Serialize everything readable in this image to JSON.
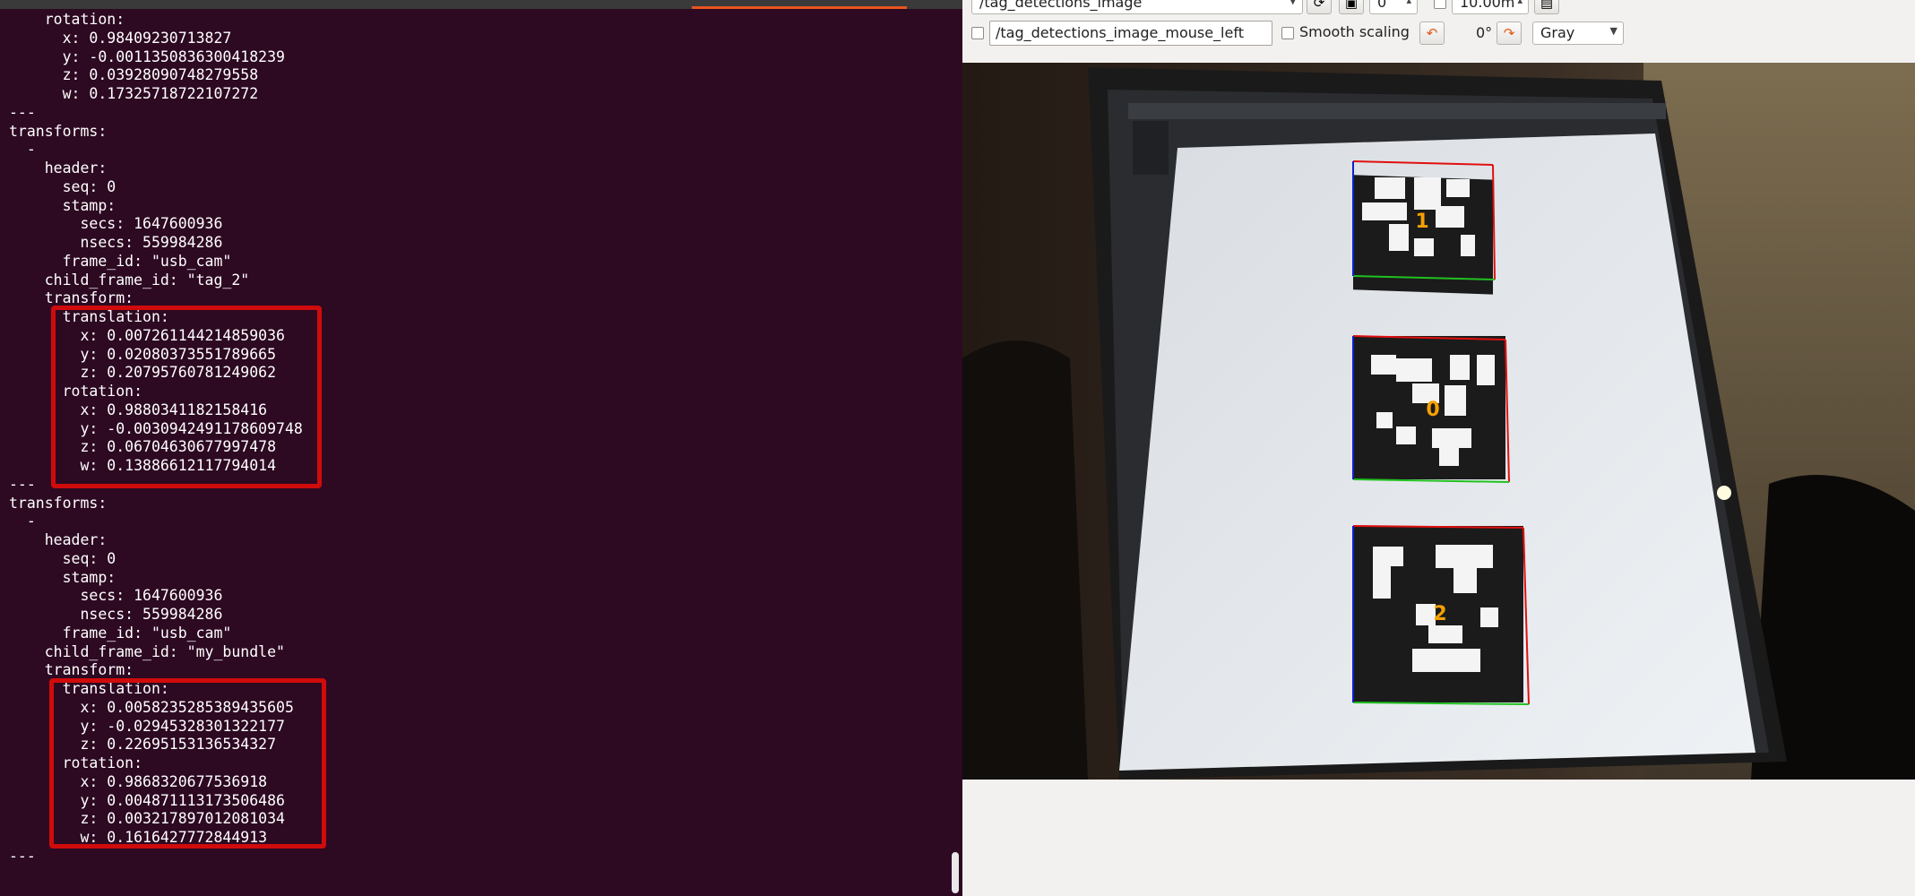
{
  "terminal": {
    "lines": [
      "    rotation:",
      "      x: 0.98409230713827",
      "      y: -0.0011350836300418239",
      "      z: 0.03928090748279558",
      "      w: 0.17325718722107272",
      "---",
      "transforms:",
      "  -",
      "    header:",
      "      seq: 0",
      "      stamp:",
      "        secs: 1647600936",
      "        nsecs: 559984286",
      "      frame_id: \"usb_cam\"",
      "    child_frame_id: \"tag_2\"",
      "    transform:",
      "      translation:",
      "        x: 0.007261144214859036",
      "        y: 0.02080373551789665",
      "        z: 0.20795760781249062",
      "      rotation:",
      "        x: 0.9880341182158416",
      "        y: -0.0030942491178609748",
      "        z: 0.06704630677997478",
      "        w: 0.1388661211779401​4",
      "---",
      "transforms:",
      "  -",
      "    header:",
      "      seq: 0",
      "      stamp:",
      "        secs: 1647600936",
      "        nsecs: 559984286",
      "      frame_id: \"usb_cam\"",
      "    child_frame_id: \"my_bundle\"",
      "    transform:",
      "      translation:",
      "        x: 0.0058235285389435605",
      "        y: -0.02945328301322177",
      "        z: 0.22695153136534327",
      "      rotation:",
      "        x: 0.9868320677536918",
      "        y: 0.004871113173506486",
      "        z: 0.003217897012081034",
      "        w: 0.1616427772844913",
      "---"
    ]
  },
  "toolbar": {
    "topic": "/tag_detections_image",
    "spin_value": "0",
    "max_value": "10.00m",
    "mouse_topic": "/tag_detections_image_mouse_left",
    "smooth_scaling_label": "Smooth scaling",
    "rotation_label": "0°",
    "color_scheme": "Gray"
  },
  "image": {
    "tag_ids": [
      "1",
      "0",
      "2"
    ],
    "colors": {
      "tag_label": "#f5a000",
      "axis_red": "#e01010",
      "axis_green": "#20c020",
      "axis_blue": "#1020d0"
    }
  }
}
